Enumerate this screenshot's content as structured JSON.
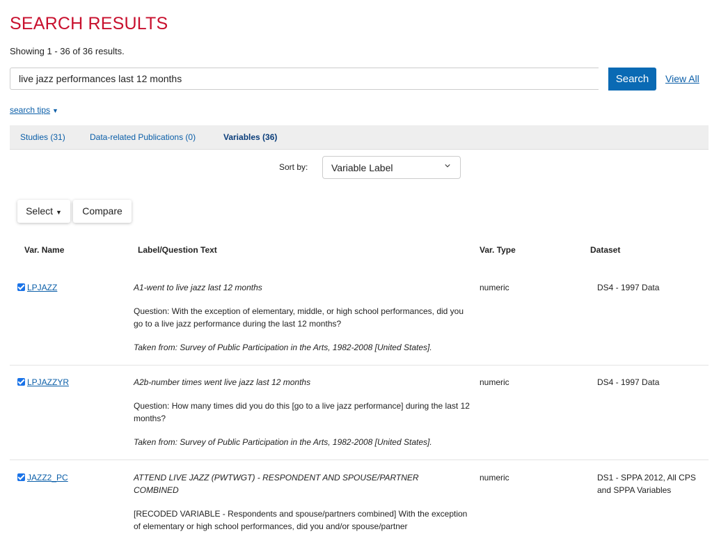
{
  "page": {
    "title": "SEARCH RESULTS",
    "showing": "Showing 1 - 36 of 36 results."
  },
  "search": {
    "value": "live jazz performances last 12 months",
    "button": "Search",
    "view_all": "View All",
    "tips": "search tips"
  },
  "tabs": [
    {
      "label": "Studies (31)"
    },
    {
      "label": "Data-related Publications (0)"
    },
    {
      "label": "Variables (36)",
      "active": true
    }
  ],
  "sort": {
    "label": "Sort by:",
    "selected": "Variable Label"
  },
  "actions": {
    "select": "Select",
    "compare": "Compare"
  },
  "table": {
    "headers": [
      "Var. Name",
      "Label/Question Text",
      "Var. Type",
      "Dataset"
    ],
    "rows": [
      {
        "checked": true,
        "name": "LPJAZZ",
        "label": "A1-went to live jazz last 12 months",
        "question": "Question: With the exception of elementary, middle, or high school performances, did you go to a live jazz performance during the last 12 months?",
        "taken": "Taken from: Survey of Public Participation in the Arts, 1982-2008 [United States].",
        "type": "numeric",
        "dataset": "DS4 - 1997 Data"
      },
      {
        "checked": true,
        "name": "LPJAZZYR",
        "label": "A2b-number times went live jazz last 12 months",
        "question": "Question: How many times did you do this [go to a live jazz performance] during the last 12 months?",
        "taken": "Taken from: Survey of Public Participation in the Arts, 1982-2008 [United States].",
        "type": "numeric",
        "dataset": "DS4 - 1997 Data"
      },
      {
        "checked": true,
        "name": "JAZZ2_PC",
        "label": "ATTEND LIVE JAZZ (PWTWGT) - RESPONDENT AND SPOUSE/PARTNER COMBINED",
        "question": "[RECODED VARIABLE - Respondents and spouse/partners combined] With the exception of elementary or high school performances, did you and/or spouse/partner",
        "taken": "",
        "type": "numeric",
        "dataset": "DS1 - SPPA 2012, All CPS and SPPA Variables"
      }
    ]
  },
  "colors": {
    "title": "#c8102e",
    "link": "#0a5ea8",
    "primary_button": "#0a6ab4",
    "tab_bar": "#eeeeee"
  }
}
